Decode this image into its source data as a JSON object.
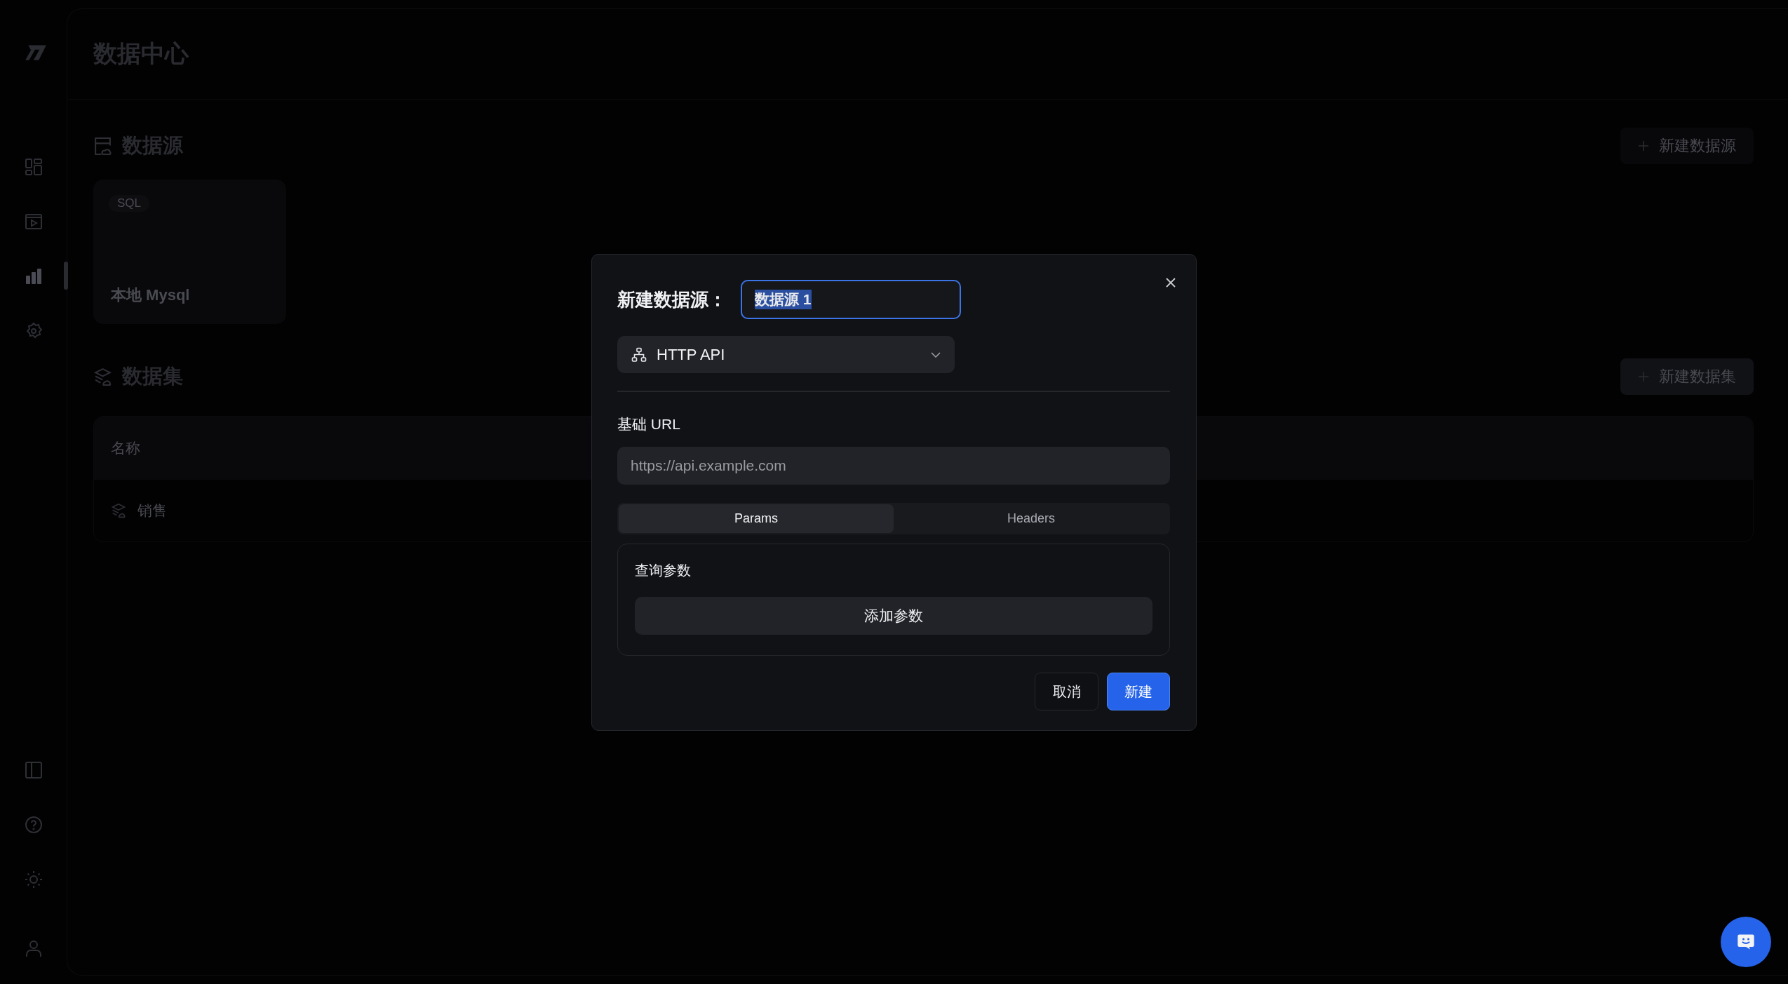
{
  "sidebar": {
    "nav": [
      {
        "kind": "layout",
        "selected": false
      },
      {
        "kind": "media",
        "selected": false
      },
      {
        "kind": "chart",
        "selected": true
      },
      {
        "kind": "settings",
        "selected": false
      }
    ],
    "bottom": [
      {
        "kind": "panel"
      },
      {
        "kind": "help"
      },
      {
        "kind": "theme"
      },
      {
        "kind": "user"
      }
    ]
  },
  "page": {
    "title": "数据中心"
  },
  "datasources": {
    "title": "数据源",
    "button": "新建数据源",
    "cards": [
      {
        "tag": "SQL",
        "name": "本地 Mysql"
      }
    ]
  },
  "datasets": {
    "title": "数据集",
    "button": "新建数据集",
    "table": {
      "columns": [
        "名称"
      ],
      "rows": [
        {
          "name": "销售"
        }
      ]
    }
  },
  "dialog": {
    "title": "新建数据源：",
    "name_value": "数据源 1",
    "name_text_selected": true,
    "type": "HTTP API",
    "url_label": "基础 URL",
    "url_placeholder": "https://api.example.com",
    "tabs": [
      {
        "label": "Params",
        "selected": true
      },
      {
        "label": "Headers",
        "selected": false
      }
    ],
    "panel_title": "查询参数",
    "add_button": "添加参数",
    "cancel": "取消",
    "create": "新建"
  }
}
